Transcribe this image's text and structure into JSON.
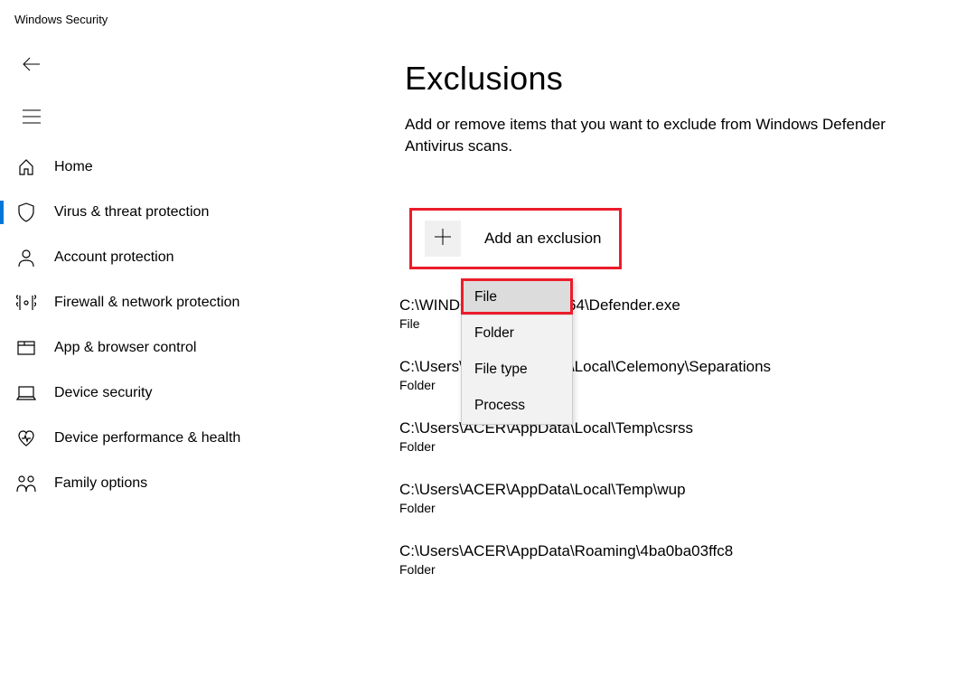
{
  "app_title": "Windows Security",
  "sidebar": {
    "items": [
      {
        "id": "home",
        "label": "Home",
        "active": false
      },
      {
        "id": "virus",
        "label": "Virus & threat protection",
        "active": true
      },
      {
        "id": "account",
        "label": "Account protection",
        "active": false
      },
      {
        "id": "firewall",
        "label": "Firewall & network protection",
        "active": false
      },
      {
        "id": "app-browser",
        "label": "App & browser control",
        "active": false
      },
      {
        "id": "device-security",
        "label": "Device security",
        "active": false
      },
      {
        "id": "device-performance",
        "label": "Device performance & health",
        "active": false
      },
      {
        "id": "family",
        "label": "Family options",
        "active": false
      }
    ]
  },
  "main": {
    "title": "Exclusions",
    "description": "Add or remove items that you want to exclude from Windows Defender Antivirus scans.",
    "add_button_label": "Add an exclusion",
    "dropdown": {
      "options": [
        "File",
        "Folder",
        "File type",
        "Process"
      ],
      "selected_index": 0
    },
    "exclusions": [
      {
        "path": "C:\\WINDOWS\\SysWOW64\\Defender.exe",
        "type": "File"
      },
      {
        "path": "C:\\Users\\ACER\\AppData\\Local\\Celemony\\Separations",
        "type": "Folder"
      },
      {
        "path": "C:\\Users\\ACER\\AppData\\Local\\Temp\\csrss",
        "type": "Folder"
      },
      {
        "path": "C:\\Users\\ACER\\AppData\\Local\\Temp\\wup",
        "type": "Folder"
      },
      {
        "path": "C:\\Users\\ACER\\AppData\\Roaming\\4ba0ba03ffc8",
        "type": "Folder"
      }
    ]
  }
}
